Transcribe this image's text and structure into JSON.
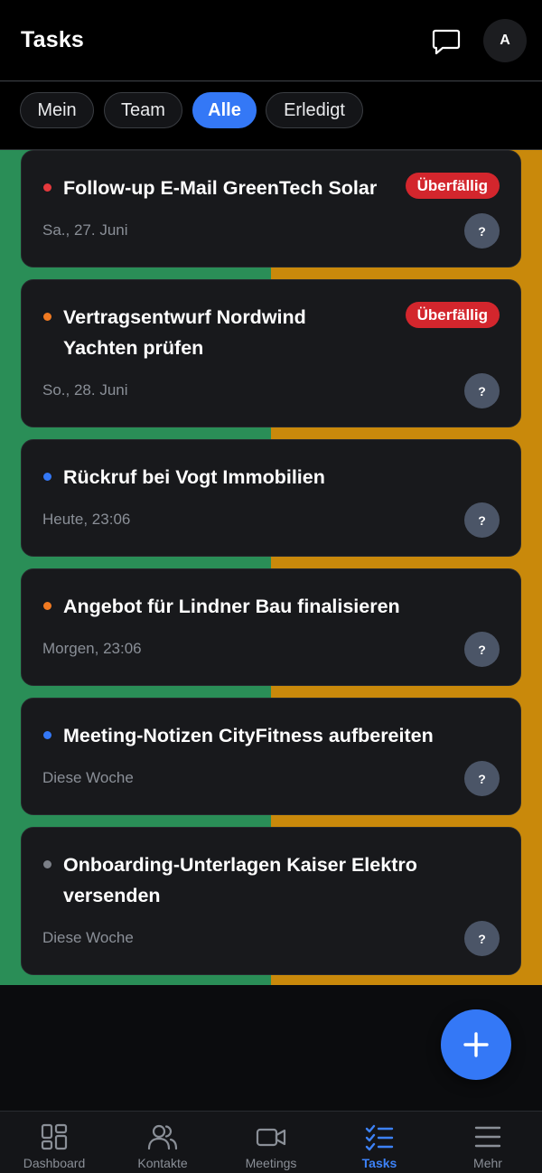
{
  "header": {
    "title": "Tasks",
    "avatar_initial": "A"
  },
  "filters": [
    {
      "label": "Mein",
      "active": false
    },
    {
      "label": "Team",
      "active": false
    },
    {
      "label": "Alle",
      "active": true
    },
    {
      "label": "Erledigt",
      "active": false
    }
  ],
  "tasks": [
    {
      "title": "Follow-up E-Mail GreenTech Solar",
      "date": "Sa., 27. Juni",
      "badge": "Überfällig",
      "priority_color": "#e5393d",
      "assignee": "?"
    },
    {
      "title": "Vertragsentwurf Nordwind Yachten prüfen",
      "date": "So., 28. Juni",
      "badge": "Überfällig",
      "priority_color": "#f07a22",
      "assignee": "?"
    },
    {
      "title": "Rückruf bei Vogt Immobilien",
      "date": "Heute, 23:06",
      "badge": "",
      "priority_color": "#3478f6",
      "assignee": "?"
    },
    {
      "title": "Angebot für Lindner Bau finalisieren",
      "date": "Morgen, 23:06",
      "badge": "",
      "priority_color": "#f07a22",
      "assignee": "?"
    },
    {
      "title": "Meeting-Notizen CityFitness aufbereiten",
      "date": "Diese Woche",
      "badge": "",
      "priority_color": "#3478f6",
      "assignee": "?"
    },
    {
      "title": "Onboarding-Unterlagen Kaiser Elektro versenden",
      "date": "Diese Woche",
      "badge": "",
      "priority_color": "#7b7f87",
      "assignee": "?"
    }
  ],
  "tabbar": {
    "items": [
      {
        "label": "Dashboard",
        "icon": "grid-icon",
        "active": false
      },
      {
        "label": "Kontakte",
        "icon": "people-icon",
        "active": false
      },
      {
        "label": "Meetings",
        "icon": "video-icon",
        "active": false
      },
      {
        "label": "Tasks",
        "icon": "checklist-icon",
        "active": true
      },
      {
        "label": "Mehr",
        "icon": "menu-icon",
        "active": false
      }
    ]
  },
  "colors": {
    "accent": "#3478f6",
    "overdue": "#d3262d",
    "band_left": "#2a8e57",
    "band_right": "#c9890b"
  }
}
